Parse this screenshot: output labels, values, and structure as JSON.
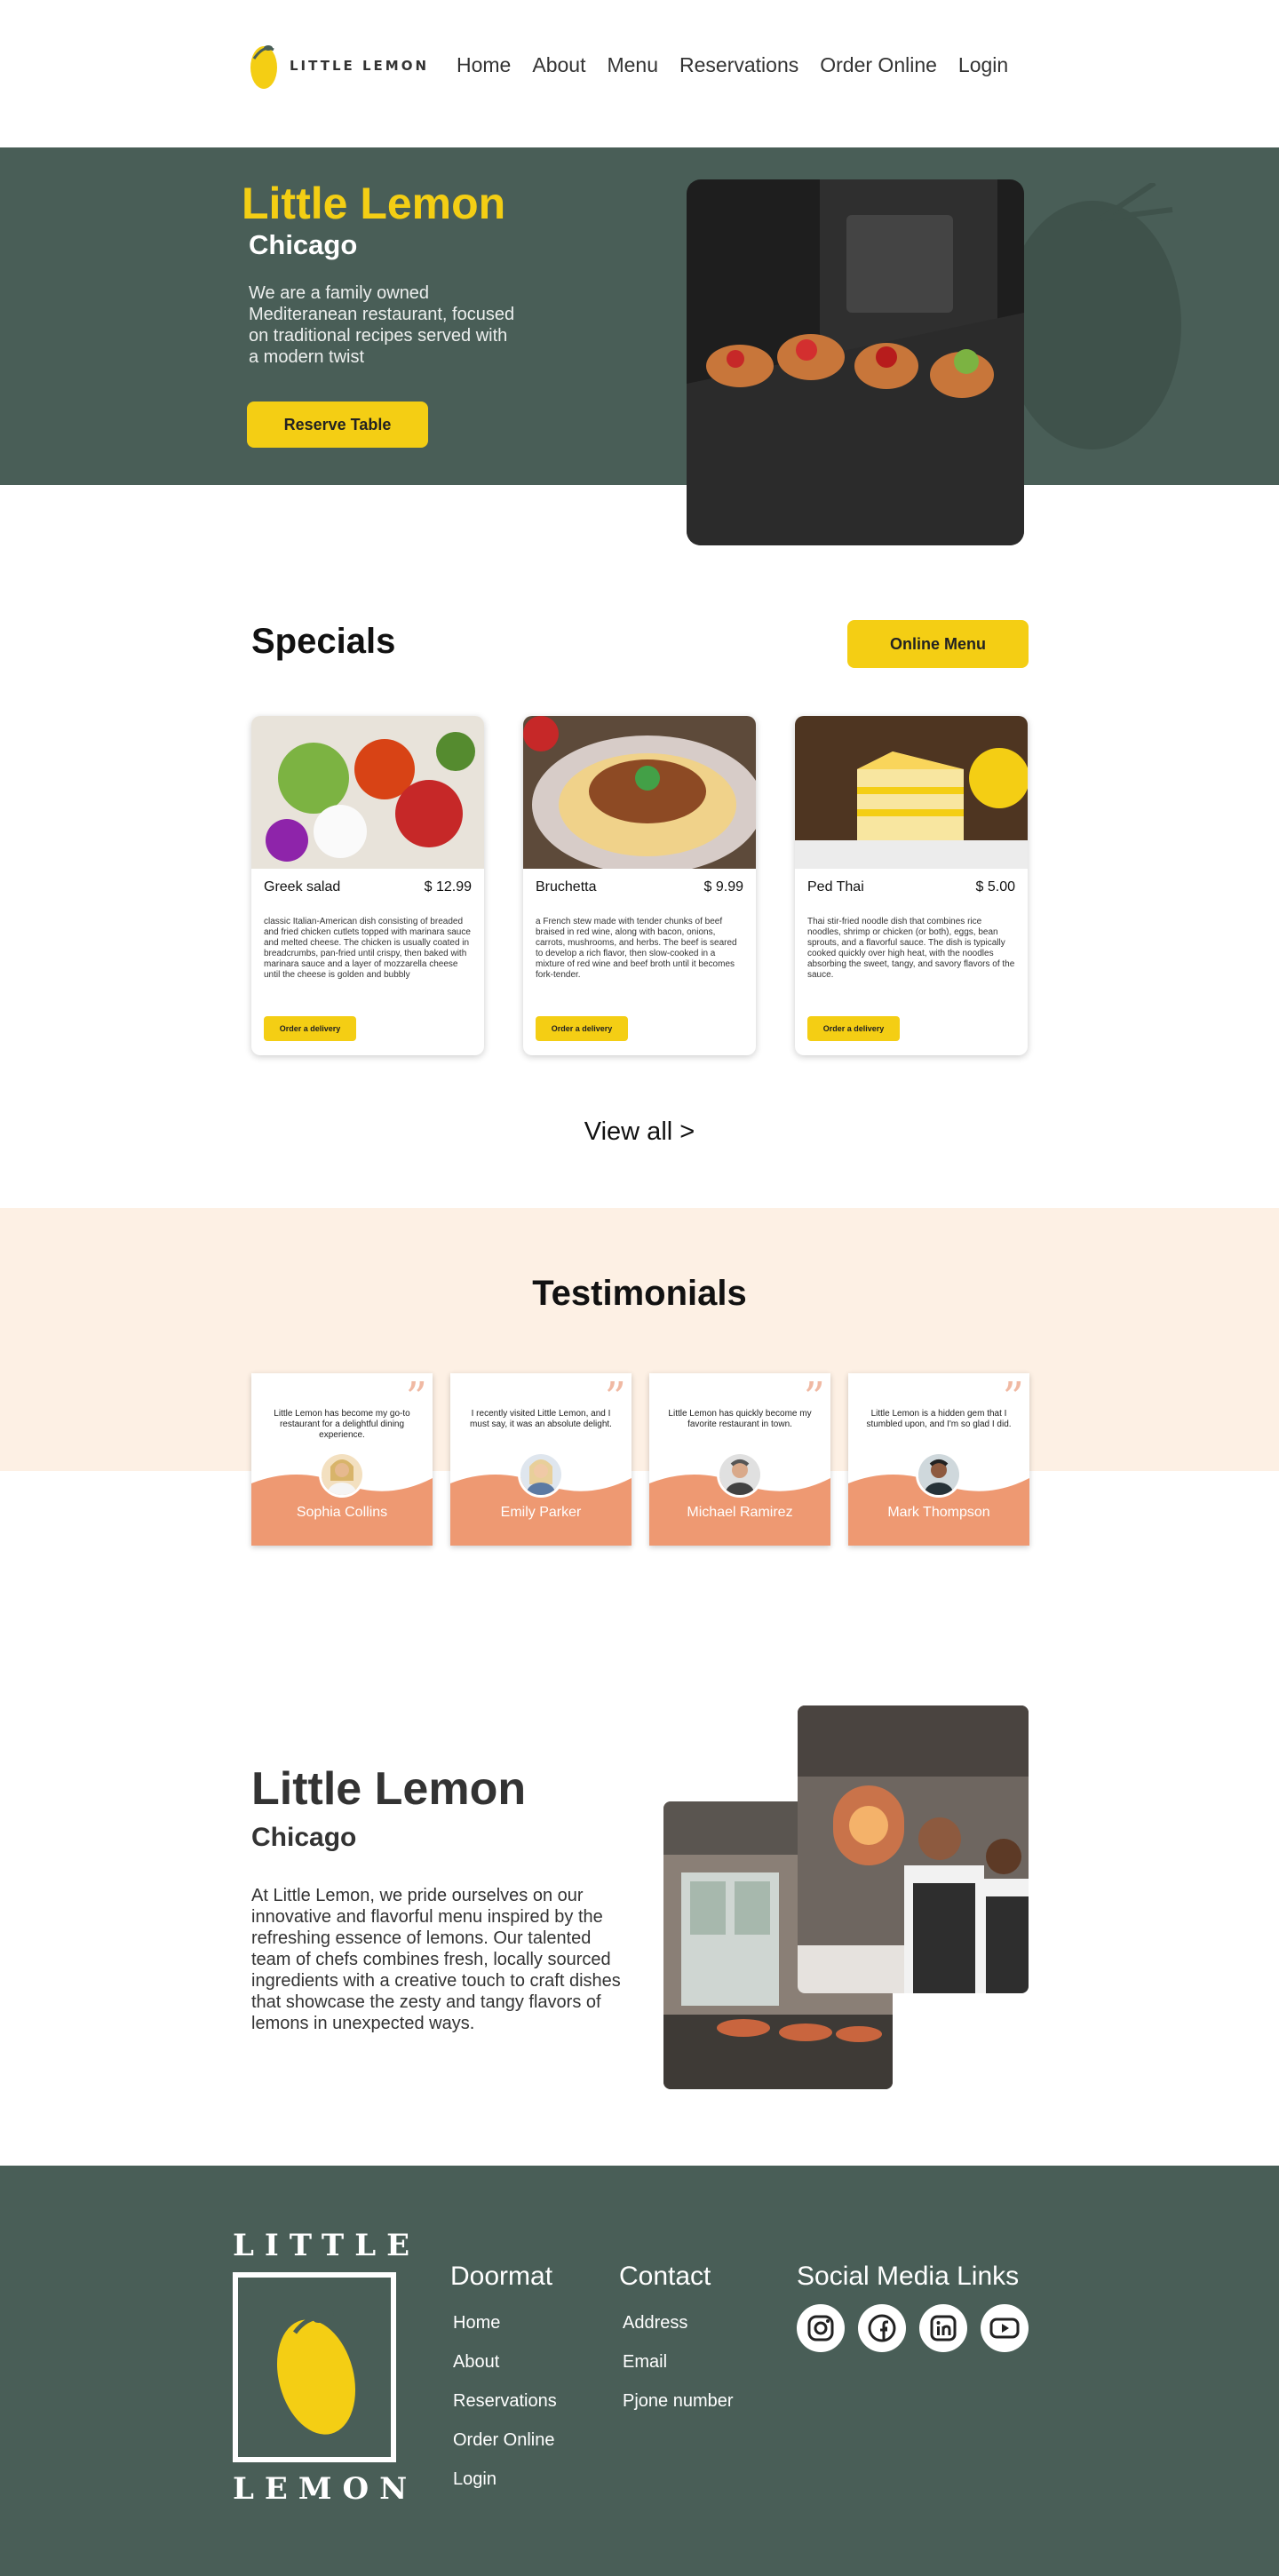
{
  "header": {
    "logo_text": "LITTLE LEMON",
    "nav": [
      "Home",
      "About",
      "Menu",
      "Reservations",
      "Order Online",
      "Login"
    ]
  },
  "hero": {
    "title": "Little Lemon",
    "subtitle": "Chicago",
    "description": "We are a family owned Mediteranean restaurant, focused on traditional recipes served with a modern twist",
    "button": "Reserve Table"
  },
  "specials": {
    "title": "Specials",
    "menu_button": "Online Menu",
    "cards": [
      {
        "name": "Greek salad",
        "price": "$ 12.99",
        "description": "classic Italian-American dish consisting of breaded and fried chicken cutlets topped with marinara sauce and melted cheese. The chicken is usually coated in breadcrumbs, pan-fried until crispy, then baked with marinara sauce and a layer of mozzarella cheese until the cheese is golden and bubbly",
        "button": "Order a delivery"
      },
      {
        "name": "Bruchetta",
        "price": "$ 9.99",
        "description": "a French stew made with tender chunks of beef braised in red wine, along with bacon, onions, carrots, mushrooms, and herbs. The beef is seared to develop a rich flavor, then slow-cooked in a mixture of red wine and beef broth until it becomes fork-tender.",
        "button": "Order a delivery"
      },
      {
        "name": "Ped Thai",
        "price": "$ 5.00",
        "description": "Thai stir-fried noodle dish that combines rice noodles, shrimp or chicken (or both), eggs, bean sprouts, and a flavorful sauce. The dish is typically cooked quickly over high heat, with the noodles absorbing the sweet, tangy, and savory flavors of the sauce.",
        "button": "Order a delivery"
      }
    ],
    "view_all": "View all >"
  },
  "testimonials": {
    "title": "Testimonials",
    "items": [
      {
        "text": "Little Lemon has become my go-to restaurant for a delightful dining experience.",
        "name": "Sophia Collins"
      },
      {
        "text": "I recently visited Little Lemon, and I must say, it was an absolute delight.",
        "name": "Emily Parker"
      },
      {
        "text": "Little Lemon has quickly become my favorite restaurant in town.",
        "name": "Michael Ramirez"
      },
      {
        "text": "Little Lemon is a hidden gem that I stumbled upon, and I'm so glad I did.",
        "name": "Mark Thompson"
      }
    ]
  },
  "about": {
    "title": "Little Lemon",
    "subtitle": "Chicago",
    "description": "At Little Lemon, we pride ourselves on our innovative and flavorful menu inspired by the refreshing essence of lemons. Our talented team of chefs combines fresh, locally sourced ingredients with a creative touch to craft dishes that showcase the zesty and tangy flavors of lemons in unexpected ways."
  },
  "footer": {
    "logo_top": "LITTLE",
    "logo_bottom": "LEMON",
    "doormat_title": "Doormat",
    "doormat_links": [
      "Home",
      "About",
      "Reservations",
      "Order Online",
      "Login"
    ],
    "contact_title": "Contact",
    "contact_links": [
      "Address",
      "Email",
      "Pjone number"
    ],
    "social_title": "Social Media Links",
    "social_icons": [
      "instagram-icon",
      "facebook-icon",
      "linkedin-icon",
      "youtube-icon"
    ]
  },
  "colors": {
    "green": "#495e57",
    "yellow": "#f4ce14",
    "peach": "#fdf0e4",
    "salmon": "#ee9972"
  }
}
